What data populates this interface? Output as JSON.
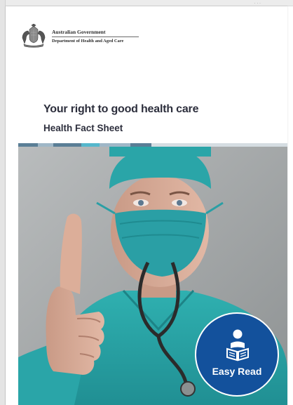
{
  "document": {
    "agency_line1": "Australian Government",
    "agency_line2": "Department of Health and Aged Care",
    "title": "Your right to good health care",
    "subtitle": "Health Fact Sheet",
    "badge_label": "Easy Read",
    "corner_mark": "·  ·  ·"
  },
  "stripe_colors": [
    "#5a7e96",
    "#9fb7c7",
    "#5a7e96",
    "#55b7cc",
    "#9fb7c7",
    "#5a7e96",
    "#d5dde2"
  ],
  "icons": {
    "crest": "coat-of-arms-icon",
    "badge": "person-reading-icon"
  },
  "colors": {
    "title": "#2d2f3d",
    "badge_blue": "#13519c",
    "scrubs": "#2aa5a8"
  }
}
